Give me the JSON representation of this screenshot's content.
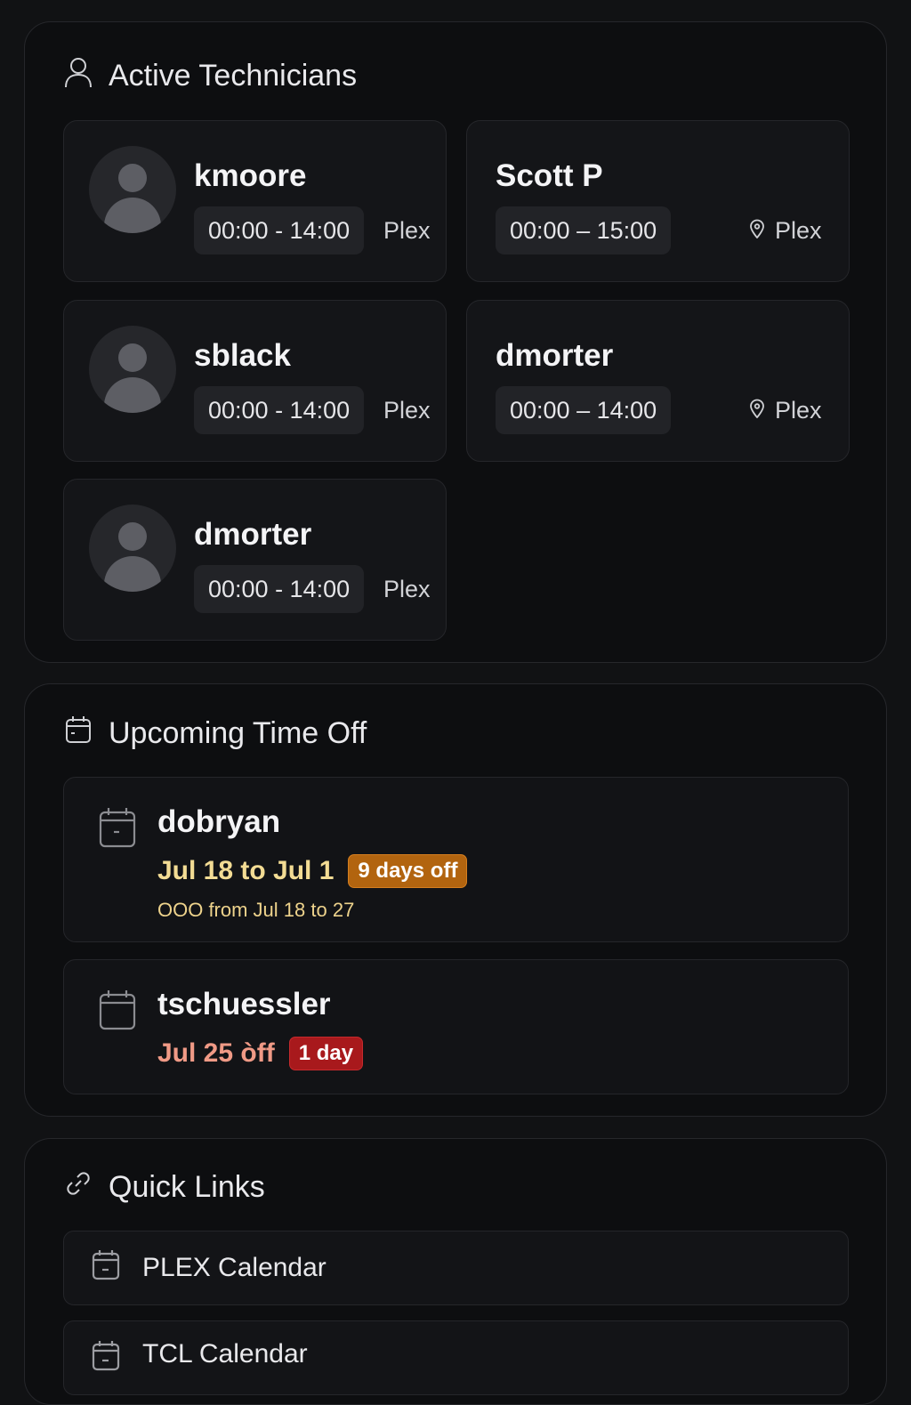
{
  "active_technicians": {
    "title": "Active Technicians",
    "title_icon": "user-icon",
    "items": [
      {
        "name": "kmoore",
        "hours": "00:00 - 14:00",
        "location": "Plex",
        "has_avatar": true
      },
      {
        "name": "Scott P",
        "hours": "00:00 – 15:00",
        "location": "Plex",
        "has_avatar": false,
        "location_icon": "map-pin-icon"
      },
      {
        "name": "sblack",
        "hours": "00:00 - 14:00",
        "location": "Plex",
        "has_avatar": true
      },
      {
        "name": "dmorter",
        "hours": "00:00 – 14:00",
        "location": "Plex",
        "has_avatar": false,
        "location_icon": "map-pin-icon"
      },
      {
        "name": "dmorter",
        "hours": "00:00 - 14:00",
        "location": "Plex",
        "has_avatar": true
      }
    ]
  },
  "upcoming_time_off": {
    "title": "Upcoming Time Off",
    "title_icon": "calendar-icon",
    "items": [
      {
        "name": "dobryan",
        "dates": "Jul 18 to Jul 1",
        "badge": "9 days off",
        "note": "OOO from Jul 18 to 27",
        "date_color": "#f3dc94",
        "badge_color": "#b2640f"
      },
      {
        "name": "tschuessler",
        "dates": "Jul 25 òff",
        "badge": "1 day",
        "date_color": "#f09a86",
        "badge_color": "#a8191c"
      }
    ]
  },
  "quick_links": {
    "title": "Quick Links",
    "title_icon": "link-icon",
    "items": [
      {
        "label": "PLEX Calendar",
        "icon": "calendar-icon"
      },
      {
        "label": "TCL Calendar",
        "icon": "calendar-icon"
      }
    ]
  }
}
